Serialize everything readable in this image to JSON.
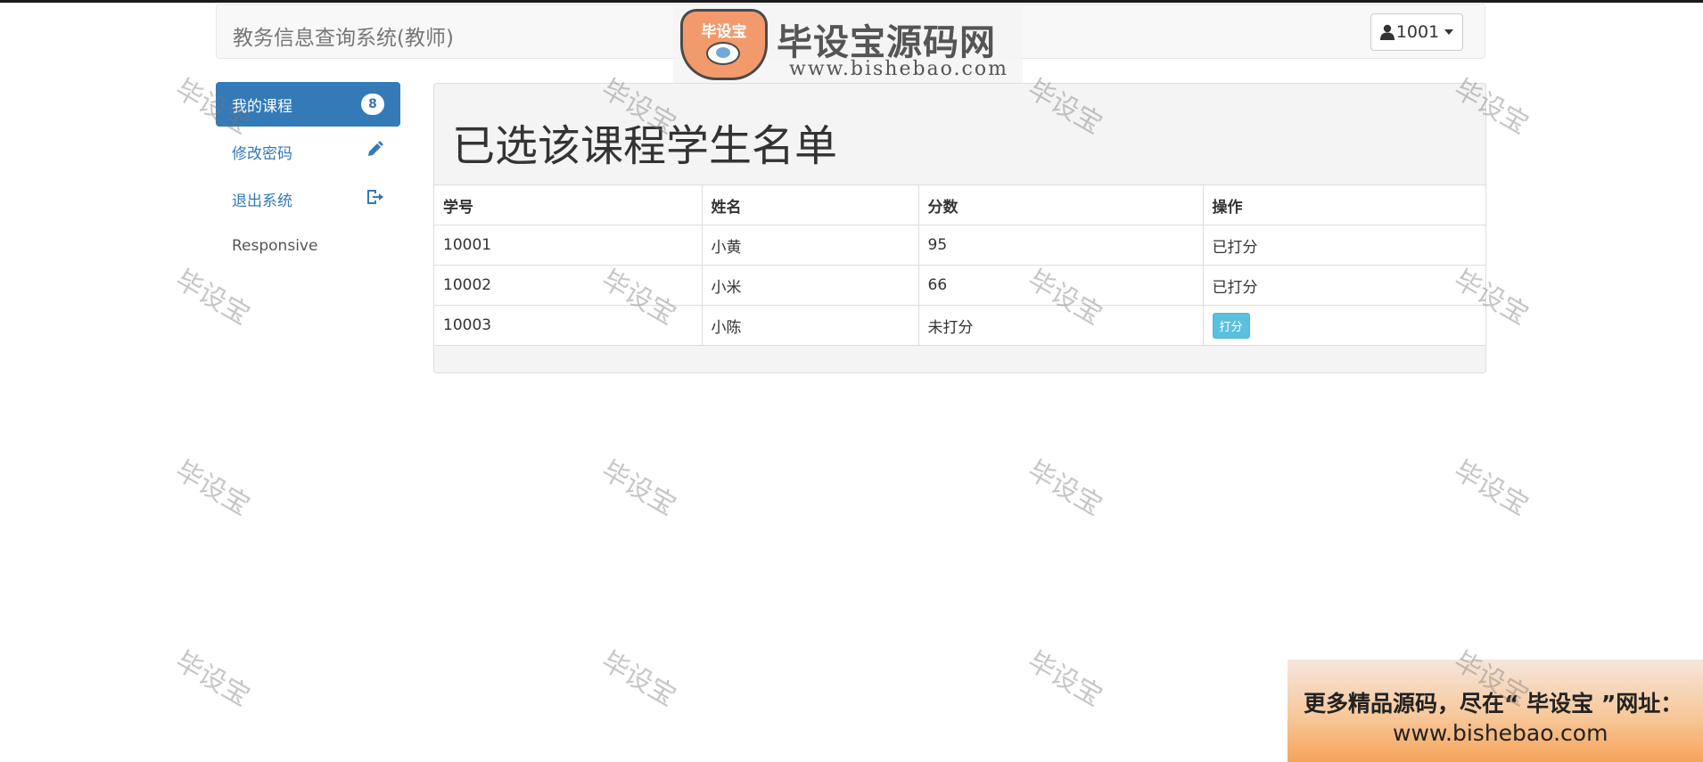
{
  "navbar": {
    "brand": "教务信息查询系统(教师)",
    "user_label": "1001",
    "user_icon": "user-icon"
  },
  "logo": {
    "badge_text": "毕设宝",
    "title": "毕设宝源码网",
    "url": "www.bishebao.com"
  },
  "sidebar": {
    "items": [
      {
        "label": "我的课程",
        "badge": "8",
        "icon": "",
        "active": true
      },
      {
        "label": "修改密码",
        "icon": "pencil-icon"
      },
      {
        "label": "退出系统",
        "icon": "logout-icon"
      },
      {
        "label": "Responsive",
        "icon": ""
      }
    ]
  },
  "main": {
    "title": "已选该课程学生名单",
    "table": {
      "headers": [
        "学号",
        "姓名",
        "分数",
        "操作"
      ],
      "rows": [
        {
          "id": "10001",
          "name": "小黄",
          "score": "95",
          "action": "已打分"
        },
        {
          "id": "10002",
          "name": "小米",
          "score": "66",
          "action": "已打分"
        },
        {
          "id": "10003",
          "name": "小陈",
          "score": "未打分",
          "action": "打分"
        }
      ]
    }
  },
  "watermark": "毕设宝",
  "ad": {
    "line1": "更多精品源码，尽在“ 毕设宝 ”网址：",
    "line2": "www.bishebao.com"
  },
  "colors": {
    "primary": "#337ab7",
    "info": "#5bc0de"
  }
}
